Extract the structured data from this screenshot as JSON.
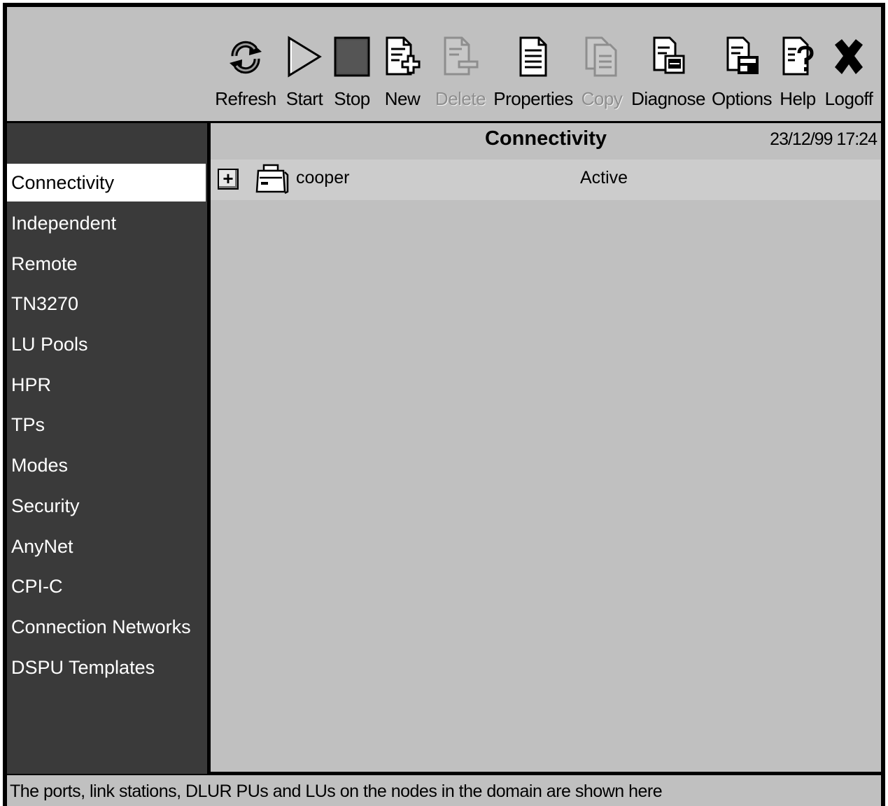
{
  "toolbar": {
    "buttons": [
      {
        "label": "Refresh",
        "icon": "refresh-icon",
        "enabled": true
      },
      {
        "label": "Start",
        "icon": "start-triangle-icon",
        "enabled": true
      },
      {
        "label": "Stop",
        "icon": "stop-square-icon",
        "enabled": true
      },
      {
        "label": "New",
        "icon": "new-document-icon",
        "enabled": true
      },
      {
        "label": "Delete",
        "icon": "delete-document-icon",
        "enabled": false
      },
      {
        "label": "Properties",
        "icon": "properties-document-icon",
        "enabled": true
      },
      {
        "label": "Copy",
        "icon": "copy-documents-icon",
        "enabled": false
      },
      {
        "label": "Diagnose",
        "icon": "diagnose-icon",
        "enabled": true
      },
      {
        "label": "Options",
        "icon": "options-icon",
        "enabled": true
      },
      {
        "label": "Help",
        "icon": "help-document-icon",
        "enabled": true
      },
      {
        "label": "Logoff",
        "icon": "logoff-x-icon",
        "enabled": true
      }
    ]
  },
  "sidebar": {
    "items": [
      {
        "label": "Connectivity",
        "active": true
      },
      {
        "label": "Independent"
      },
      {
        "label": "Remote"
      },
      {
        "label": "TN3270"
      },
      {
        "label": "LU Pools"
      },
      {
        "label": "HPR"
      },
      {
        "label": "TPs"
      },
      {
        "label": "Modes"
      },
      {
        "label": "Security"
      },
      {
        "label": "AnyNet"
      },
      {
        "label": "CPI-C"
      },
      {
        "label": "Connection Networks"
      },
      {
        "label": "DSPU Templates"
      }
    ]
  },
  "main": {
    "title": "Connectivity",
    "timestamp": "23/12/99 17:24",
    "tree": [
      {
        "expander": "+",
        "icon": "computer-node-icon",
        "name": "cooper",
        "status": "Active"
      }
    ]
  },
  "status_bar": {
    "text": "The ports, link stations, DLUR PUs and LUs on the nodes in the domain are shown here"
  },
  "colors": {
    "window_background": "#c0c0c0",
    "sidebar_background": "#3a3a3a",
    "sidebar_text": "#ffffff",
    "active_item_background": "#ffffff",
    "disabled_text": "#8e8e8e"
  }
}
